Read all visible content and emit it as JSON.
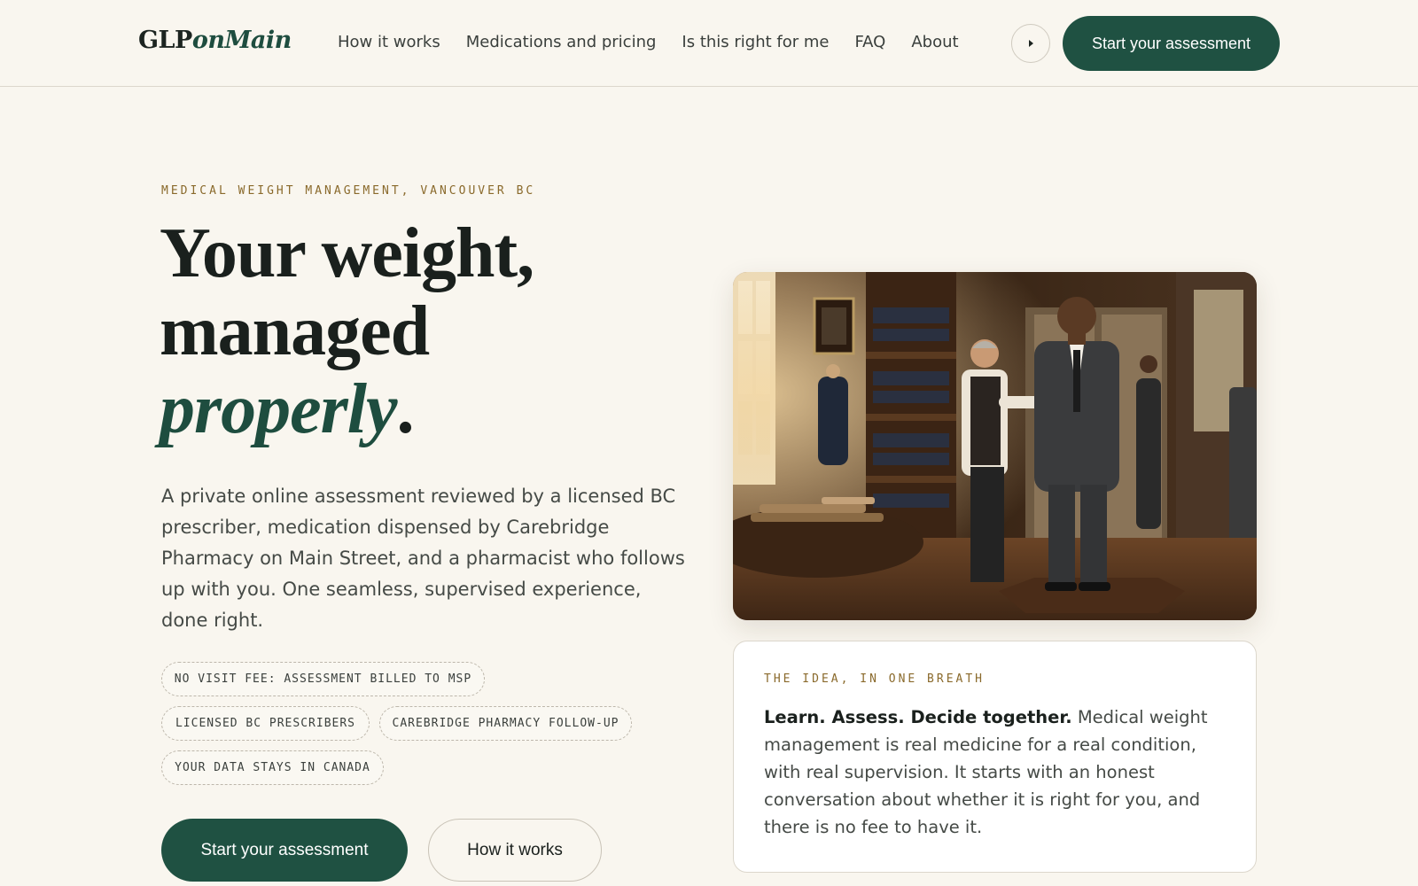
{
  "header": {
    "logo_main": "GLP",
    "logo_accent": "onMain",
    "nav": [
      {
        "label": "How it works"
      },
      {
        "label": "Medications and pricing"
      },
      {
        "label": "Is this right for me"
      },
      {
        "label": "FAQ"
      },
      {
        "label": "About"
      }
    ],
    "round_button_icon": "play-icon",
    "cta_label": "Start your assessment"
  },
  "hero": {
    "eyebrow": "MEDICAL WEIGHT MANAGEMENT, VANCOUVER BC",
    "headline_line1": "Your weight,",
    "headline_line2": "managed",
    "headline_em": "properly",
    "headline_period": ".",
    "lead": "A private online assessment reviewed by a licensed BC prescriber, medication dispensed by Carebridge Pharmacy on Main Street, and a pharmacist who follows up with you. One seamless, supervised experience, done right.",
    "pills": [
      "NO VISIT FEE: ASSESSMENT BILLED TO MSP",
      "LICENSED BC PRESCRIBERS",
      "CAREBRIDGE PHARMACY FOLLOW-UP",
      "YOUR DATA STAYS IN CANADA"
    ],
    "primary_button": "Start your assessment",
    "secondary_button": "How it works"
  },
  "card": {
    "eyebrow": "THE IDEA, IN ONE BREATH",
    "strong": "Learn. Assess. Decide together.",
    "body": " Medical weight management is real medicine for a real condition, with real supervision. It starts with an honest conversation about whether it is right for you, and there is no fee to have it."
  },
  "colors": {
    "background": "#f9f6ef",
    "brand_green": "#1f5142",
    "accent_gold": "#8a6a2c"
  }
}
